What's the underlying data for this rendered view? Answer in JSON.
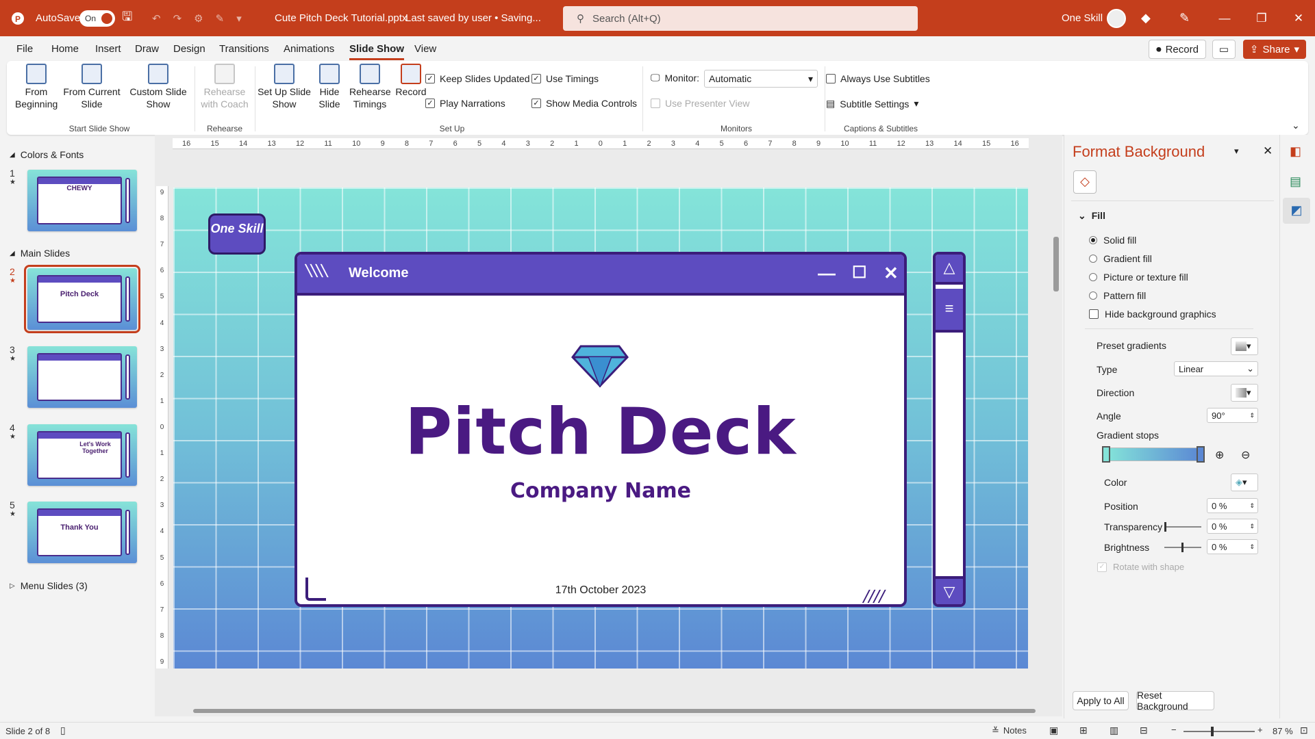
{
  "titlebar": {
    "autosave_label": "AutoSave",
    "autosave_state": "On",
    "doc_title": "Cute Pitch Deck Tutorial.pptx",
    "save_status": "Last saved by user • Saving...",
    "search_placeholder": "Search (Alt+Q)",
    "user_name": "One Skill"
  },
  "menu": {
    "tabs": [
      "File",
      "Home",
      "Insert",
      "Draw",
      "Design",
      "Transitions",
      "Animations",
      "Slide Show",
      "View"
    ],
    "active_tab": "Slide Show",
    "record_label": "Record",
    "share_label": "Share"
  },
  "ribbon": {
    "from_beginning": "From Beginning",
    "from_current": "From Current Slide",
    "custom_show": "Custom Slide Show",
    "start_group": "Start Slide Show",
    "rehearse_coach": "Rehearse with Coach",
    "rehearse_group": "Rehearse",
    "setup_show": "Set Up Slide Show",
    "hide_slide": "Hide Slide",
    "rehearse_timings": "Rehearse Timings",
    "record": "Record",
    "keep_updated": "Keep Slides Updated",
    "play_narrations": "Play Narrations",
    "use_timings": "Use Timings",
    "show_media": "Show Media Controls",
    "setup_group": "Set Up",
    "monitor_label": "Monitor:",
    "monitor_value": "Automatic",
    "presenter_view": "Use Presenter View",
    "monitors_group": "Monitors",
    "always_subtitles": "Always Use Subtitles",
    "subtitle_settings": "Subtitle Settings",
    "captions_group": "Captions & Subtitles"
  },
  "thumbnails": {
    "section1": "Colors & Fonts",
    "section2": "Main Slides",
    "section3": "Menu Slides (3)",
    "slides": [
      {
        "num": "1",
        "title": "CHEWY"
      },
      {
        "num": "2",
        "title": "Pitch Deck"
      },
      {
        "num": "3",
        "title": ""
      },
      {
        "num": "4",
        "title": "Let's Work Together"
      },
      {
        "num": "5",
        "title": "Thank You"
      }
    ]
  },
  "slide": {
    "logo": "One Skill",
    "window_title": "Welcome",
    "title": "Pitch Deck",
    "subtitle": "Company Name",
    "date": "17th October 2023"
  },
  "ruler": {
    "h_ticks": [
      "16",
      "15",
      "14",
      "13",
      "12",
      "11",
      "10",
      "9",
      "8",
      "7",
      "6",
      "5",
      "4",
      "3",
      "2",
      "1",
      "0",
      "1",
      "2",
      "3",
      "4",
      "5",
      "6",
      "7",
      "8",
      "9",
      "10",
      "11",
      "12",
      "13",
      "14",
      "15",
      "16"
    ],
    "v_ticks": [
      "9",
      "8",
      "7",
      "6",
      "5",
      "4",
      "3",
      "2",
      "1",
      "0",
      "1",
      "2",
      "3",
      "4",
      "5",
      "6",
      "7",
      "8",
      "9"
    ]
  },
  "pane": {
    "title": "Format Background",
    "fill_header": "Fill",
    "solid_fill": "Solid fill",
    "gradient_fill": "Gradient fill",
    "picture_fill": "Picture or texture fill",
    "pattern_fill": "Pattern fill",
    "hide_bg": "Hide background graphics",
    "preset_gradients": "Preset gradients",
    "type_label": "Type",
    "type_value": "Linear",
    "direction_label": "Direction",
    "angle_label": "Angle",
    "angle_value": "90°",
    "gradient_stops": "Gradient stops",
    "color_label": "Color",
    "position_label": "Position",
    "position_value": "0 %",
    "transparency_label": "Transparency",
    "transparency_value": "0 %",
    "brightness_label": "Brightness",
    "brightness_value": "0 %",
    "rotate_label": "Rotate with shape",
    "apply_all": "Apply to All",
    "reset_bg": "Reset Background"
  },
  "status": {
    "slide_info": "Slide 2 of 8",
    "notes": "Notes",
    "zoom": "87 %"
  },
  "colors": {
    "accent": "#c43e1c",
    "slide_purple": "#4a1a82",
    "window_bar": "#5d4cc0",
    "bg_top": "#84e4d9",
    "bg_bottom": "#5b88d4"
  }
}
